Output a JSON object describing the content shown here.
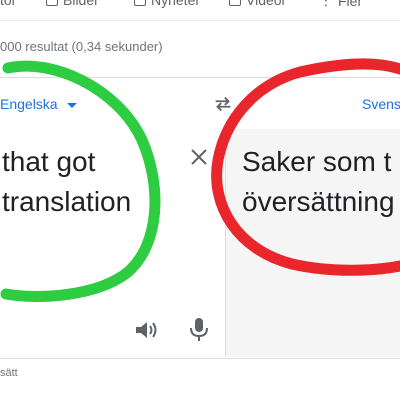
{
  "search_tabs": [
    {
      "label": "tor",
      "icon": "none"
    },
    {
      "label": "Bilder",
      "icon": "image-icon"
    },
    {
      "label": "Nyheter",
      "icon": "news-icon"
    },
    {
      "label": "Videor",
      "icon": "video-icon"
    },
    {
      "label": "Fler",
      "icon": "more-icon"
    }
  ],
  "result_stats": "000 resultat (0,34 sekunder)",
  "translate": {
    "source_language": "Engelska",
    "target_language": "Svens",
    "source_text": "that got\ntranslation",
    "target_text": "Saker som t\növersättning"
  },
  "feedback": "sätt",
  "annotations": {
    "green_circle_color": "#2ecc40",
    "red_circle_color": "#e8262b"
  },
  "colors": {
    "link_blue": "#1a73e8",
    "icon_grey": "#5f6368",
    "target_pane_bg": "#f5f5f5"
  }
}
